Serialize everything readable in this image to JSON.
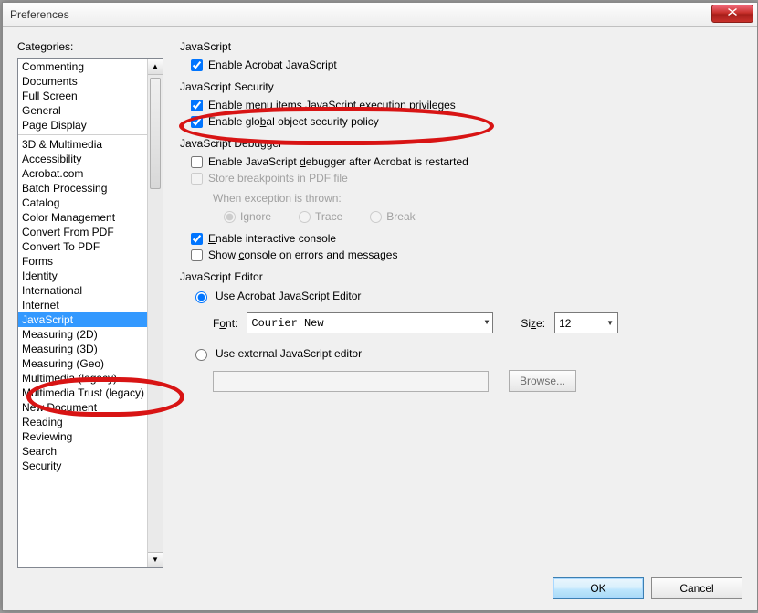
{
  "title": "Preferences",
  "sidebar": {
    "label": "Categories:",
    "group1": [
      "Commenting",
      "Documents",
      "Full Screen",
      "General",
      "Page Display"
    ],
    "group2": [
      "3D & Multimedia",
      "Accessibility",
      "Acrobat.com",
      "Batch Processing",
      "Catalog",
      "Color Management",
      "Convert From PDF",
      "Convert To PDF",
      "Forms",
      "Identity",
      "International",
      "Internet",
      "JavaScript",
      "Measuring (2D)",
      "Measuring (3D)",
      "Measuring (Geo)",
      "Multimedia (legacy)",
      "Multimedia Trust (legacy)",
      "New Document",
      "Reading",
      "Reviewing",
      "Search",
      "Security"
    ],
    "selected": "JavaScript"
  },
  "panel": {
    "sec1": {
      "title": "JavaScript",
      "enable_js": "Enable Acrobat JavaScript"
    },
    "sec2": {
      "title": "JavaScript Security",
      "menu_priv": "Enable menu items JavaScript execution privileges",
      "global_sec": "Enable global object security policy"
    },
    "sec3": {
      "title": "JavaScript Debugger",
      "enable_dbg": "Enable JavaScript debugger after Acrobat is restarted",
      "store_bp": "Store breakpoints in PDF file",
      "when_exc": "When exception is thrown:",
      "r_ignore": "Ignore",
      "r_trace": "Trace",
      "r_break": "Break",
      "interactive": "Enable interactive console",
      "show_console": "Show console on errors and messages"
    },
    "sec4": {
      "title": "JavaScript Editor",
      "use_acro": "Use Acrobat JavaScript Editor",
      "font_label": "Font:",
      "font_value": "Courier New",
      "size_label": "Size:",
      "size_value": "12",
      "use_ext": "Use external JavaScript editor",
      "browse": "Browse..."
    }
  },
  "buttons": {
    "ok": "OK",
    "cancel": "Cancel"
  }
}
